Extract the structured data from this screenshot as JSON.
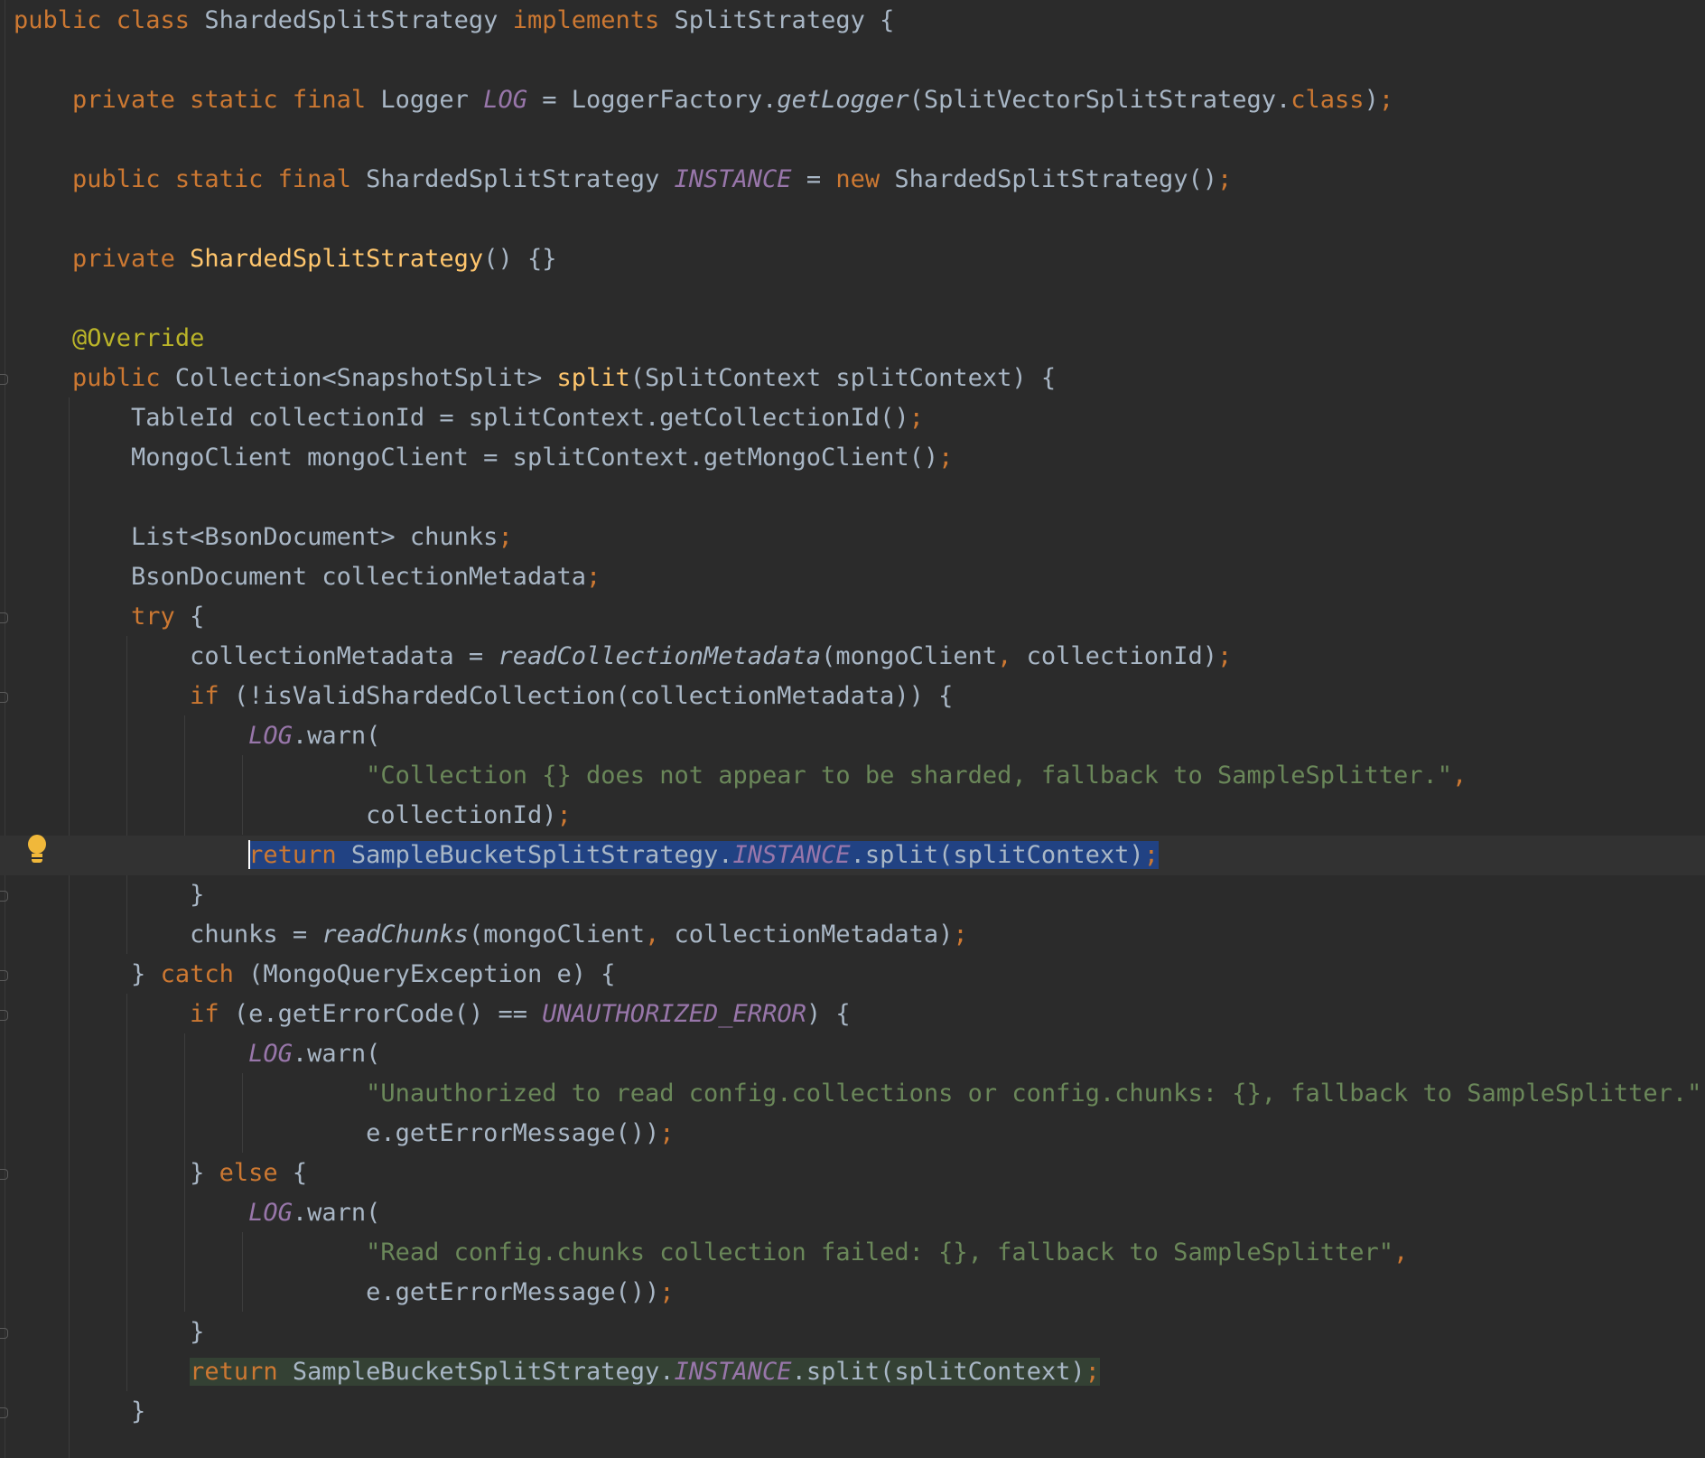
{
  "editor": {
    "language": "java",
    "theme_colors": {
      "background": "#2b2b2b",
      "text": "#a9b7c6",
      "keyword": "#cc7832",
      "method_declaration": "#ffc66d",
      "string": "#6a8759",
      "annotation": "#bbb529",
      "static_field": "#9876aa",
      "selection": "#214283",
      "highlight": "#344134"
    },
    "intention_icon": "lightbulb-icon",
    "lines": [
      [
        {
          "t": "public class ",
          "c": "kw"
        },
        {
          "t": "ShardedSplitStrategy "
        },
        {
          "t": "implements ",
          "c": "kw"
        },
        {
          "t": "SplitStrategy {"
        }
      ],
      [],
      [
        {
          "t": "    "
        },
        {
          "t": "private static final ",
          "c": "kw"
        },
        {
          "t": "Logger "
        },
        {
          "t": "LOG",
          "c": "fld"
        },
        {
          "t": " = LoggerFactory."
        },
        {
          "t": "getLogger",
          "c": "ital"
        },
        {
          "t": "(SplitVectorSplitStrategy."
        },
        {
          "t": "class",
          "c": "kw"
        },
        {
          "t": ")"
        },
        {
          "t": ";",
          "c": "pu"
        }
      ],
      [],
      [
        {
          "t": "    "
        },
        {
          "t": "public static final ",
          "c": "kw"
        },
        {
          "t": "ShardedSplitStrategy "
        },
        {
          "t": "INSTANCE",
          "c": "fld"
        },
        {
          "t": " = "
        },
        {
          "t": "new ",
          "c": "kw"
        },
        {
          "t": "ShardedSplitStrategy()"
        },
        {
          "t": ";",
          "c": "pu"
        }
      ],
      [],
      [
        {
          "t": "    "
        },
        {
          "t": "private ",
          "c": "kw"
        },
        {
          "t": "ShardedSplitStrategy",
          "c": "fn"
        },
        {
          "t": "() {}"
        }
      ],
      [],
      [
        {
          "t": "    "
        },
        {
          "t": "@Override",
          "c": "ann"
        }
      ],
      [
        {
          "t": "    "
        },
        {
          "t": "public ",
          "c": "kw"
        },
        {
          "t": "Collection<SnapshotSplit> "
        },
        {
          "t": "split",
          "c": "fn"
        },
        {
          "t": "(SplitContext splitContext) {"
        }
      ],
      [
        {
          "t": "        TableId collectionId = splitContext.getCollectionId()"
        },
        {
          "t": ";",
          "c": "pu"
        }
      ],
      [
        {
          "t": "        MongoClient mongoClient = splitContext.getMongoClient()"
        },
        {
          "t": ";",
          "c": "pu"
        }
      ],
      [],
      [
        {
          "t": "        List<BsonDocument> chunks"
        },
        {
          "t": ";",
          "c": "pu"
        }
      ],
      [
        {
          "t": "        BsonDocument collectionMetadata"
        },
        {
          "t": ";",
          "c": "pu"
        }
      ],
      [
        {
          "t": "        "
        },
        {
          "t": "try ",
          "c": "kw"
        },
        {
          "t": "{"
        }
      ],
      [
        {
          "t": "            collectionMetadata = "
        },
        {
          "t": "readCollectionMetadata",
          "c": "ital"
        },
        {
          "t": "(mongoClient"
        },
        {
          "t": ", ",
          "c": "pu"
        },
        {
          "t": "collectionId)"
        },
        {
          "t": ";",
          "c": "pu"
        }
      ],
      [
        {
          "t": "            "
        },
        {
          "t": "if ",
          "c": "kw"
        },
        {
          "t": "(!isValidShardedCollection(collectionMetadata)) {"
        }
      ],
      [
        {
          "t": "                "
        },
        {
          "t": "LOG",
          "c": "fld"
        },
        {
          "t": ".warn("
        }
      ],
      [
        {
          "t": "                        "
        },
        {
          "t": "\"Collection {} does not appear to be sharded, fallback to SampleSplitter.\"",
          "c": "str"
        },
        {
          "t": ",",
          "c": "pu"
        }
      ],
      [
        {
          "t": "                        collectionId)"
        },
        {
          "t": ";",
          "c": "pu"
        }
      ],
      [
        {
          "t": "                "
        },
        {
          "t": "|",
          "c": "caret"
        },
        {
          "t": "return ",
          "c": "kw sel"
        },
        {
          "t": "SampleBucketSplitStrategy.",
          "c": "sel"
        },
        {
          "t": "INSTANCE",
          "c": "fld sel"
        },
        {
          "t": ".split(splitContext)",
          "c": "sel"
        },
        {
          "t": ";",
          "c": "pu sel"
        }
      ],
      [
        {
          "t": "            }"
        }
      ],
      [
        {
          "t": "            chunks = "
        },
        {
          "t": "readChunks",
          "c": "ital"
        },
        {
          "t": "(mongoClient"
        },
        {
          "t": ", ",
          "c": "pu"
        },
        {
          "t": "collectionMetadata)"
        },
        {
          "t": ";",
          "c": "pu"
        }
      ],
      [
        {
          "t": "        } "
        },
        {
          "t": "catch ",
          "c": "kw"
        },
        {
          "t": "(MongoQueryException e) {"
        }
      ],
      [
        {
          "t": "            "
        },
        {
          "t": "if ",
          "c": "kw"
        },
        {
          "t": "(e.getErrorCode() == "
        },
        {
          "t": "UNAUTHORIZED_ERROR",
          "c": "fld"
        },
        {
          "t": ") {"
        }
      ],
      [
        {
          "t": "                "
        },
        {
          "t": "LOG",
          "c": "fld"
        },
        {
          "t": ".warn("
        }
      ],
      [
        {
          "t": "                        "
        },
        {
          "t": "\"Unauthorized to read config.collections or config.chunks: {}, fallback to SampleSplitter.\"",
          "c": "str"
        },
        {
          "t": ",",
          "c": "pu"
        }
      ],
      [
        {
          "t": "                        e.getErrorMessage())"
        },
        {
          "t": ";",
          "c": "pu"
        }
      ],
      [
        {
          "t": "            } "
        },
        {
          "t": "else ",
          "c": "kw"
        },
        {
          "t": "{"
        }
      ],
      [
        {
          "t": "                "
        },
        {
          "t": "LOG",
          "c": "fld"
        },
        {
          "t": ".warn("
        }
      ],
      [
        {
          "t": "                        "
        },
        {
          "t": "\"Read config.chunks collection failed: {}, fallback to SampleSplitter\"",
          "c": "str"
        },
        {
          "t": ",",
          "c": "pu"
        }
      ],
      [
        {
          "t": "                        e.getErrorMessage())"
        },
        {
          "t": ";",
          "c": "pu"
        }
      ],
      [
        {
          "t": "            }"
        }
      ],
      [
        {
          "t": "            "
        },
        {
          "t": "return ",
          "c": "kw hl"
        },
        {
          "t": "SampleBucketSplitStrategy.",
          "c": "hl"
        },
        {
          "t": "INSTANCE",
          "c": "fld hl"
        },
        {
          "t": ".split(splitContext)",
          "c": "hl"
        },
        {
          "t": ";",
          "c": "pu hl"
        }
      ],
      [
        {
          "t": "        }"
        }
      ]
    ]
  }
}
